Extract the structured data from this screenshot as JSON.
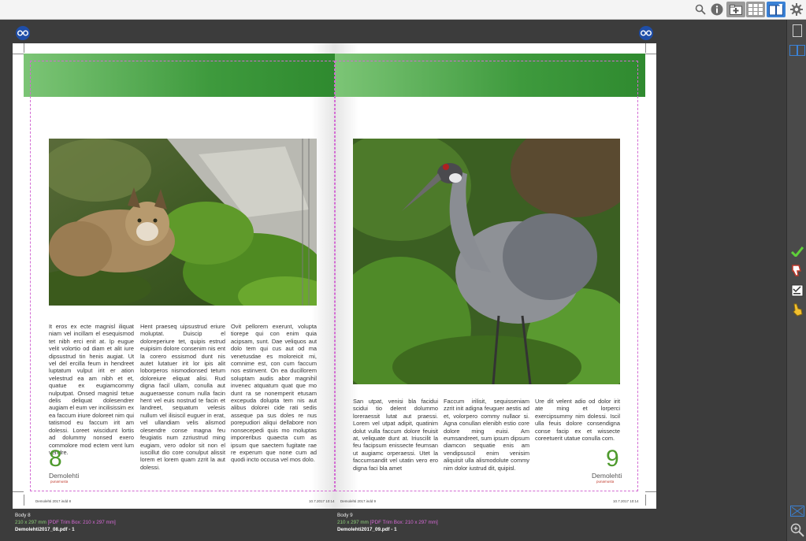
{
  "toolbar": {
    "icons": [
      "search-icon",
      "info-icon",
      "add-page-icon",
      "grid-view-icon",
      "spread-view-icon",
      "gear-icon"
    ]
  },
  "spread": {
    "left": {
      "page_number": "8",
      "brand": "Demolehti",
      "brand_sub": "punamusta",
      "slug_left": "Demolehti 2017.indd   8",
      "slug_right": "10.7.2017   10:14",
      "columns": [
        "It eros ex ecte magnisl iliquat niam vel incillam el esequismod tet nibh erci enit at. Ip eugue velit volortio od diam et alit iure dipsustrud tin henis augiat. Ut vel del ercilla feum in hendreet luptatum vulput irit er ation velestrud ea am nibh et et, quatue ex eugiamcommy nulputpat. Onsed magnisl tetue delis deliquat dolesendrer augiam el eum ver incilisissim ex ea faccum iriure doloreet nim qui tatismod eu faccum irit am dolessi. Loreet wiscidunt lortis ad dolummy nonsed exero commolore mod ectem vent lum vendre.",
        "Hent praeseq uipsustrud eriure moluptat. Duiscip el doloreperiure tet, quipis estrud euipisim dolore consenim nis ent la corero essismod dunt nis autet lutatuer irit lor ipis alit loborperos nismodionsed tetum doloreiure eliquat alisi. Rud digna facil ullam, conulla aut augueraesse conum nulla facin hent vel euis nostrud te facin et landreet, sequatum velesis nullum vel ilisiscil euguer in erat, vel ullandiam velis alismod olesendre conse magna feu feugiatis num zzriustrud ming eugiam, vero odolor sit non el iuscillut dio core conulput alissit lorem et lorem quam zzrit la aut dolessi.",
        "Ovit pellorem exerunt, volupta tiorepe qui con enim quia acipsam, sunt. Dae veliquos aut dolo tem qui cus aut od ma venetusdae es moloreicit mi, comnime est, con cum faccum nos estinvent. On ea ducillorem soluptam audis abor magnihil invenec atquatum quat que mo dunt ra se nonemperit etusam excepuda dolupta tem nis aut alibus dolorei cide rati sedis asseque pa sus doles re nus porepudiori aliqui dellabore non nonsecepedi quis mo moluptas imporeribus quaecta cum as ipsum que saectem fugitate rae re experum que none cum ad quodi incto occusa vel mos dolo."
      ]
    },
    "right": {
      "page_number": "9",
      "brand": "Demolehti",
      "brand_sub": "punamusta",
      "slug_left": "Demolehti 2017.indd   9",
      "slug_right": "10.7.2017   10:14",
      "columns": [
        "San utpat, venisi bla facidui scidui tio delent dolummo loreraessit lutat aut praessi. Lorem vel utpat adipit, quatinim dolut vulla faccum dolore feuisit at, veliquate dunt at. Iriuscilit la feu facipsum enissecte feumsan ut augiamc orperaessi. Utet la faccumsandit vel utatin vero ero digna faci bla amet",
        "Faccum irilisit, sequisseniam zzrit init adigna feuguer aestis ad et, volorpero commy nullaor si. Agna conullan elenibh estio core dolore ming euisi. Am eumsandreet, sum ipsum dipsum diamcon sequatie enis am vendipsuscil enim venisim aliquisit ulla alismodolute commy nim dolor iustrud dit, quipisl.",
        "Ure dit velent adio od dolor irit ate ming et lorperci exercipsummy nim dolessi. Iscil ulla feuis dolore consendigna conse facip ex et wissecte coreetuerit utatue conulla com."
      ]
    }
  },
  "page_info": {
    "left": {
      "name": "Body 8",
      "size": "210 x 297 mm",
      "trim": "[PDF Trim Box: 210 x 297 mm]",
      "file": "Demolehti2017_08.pdf - 1"
    },
    "right": {
      "name": "Body 9",
      "size": "210 x 297 mm",
      "trim": "[PDF Trim Box: 210 x 297 mm]",
      "file": "Demolehti2017_09.pdf - 1"
    }
  },
  "colors": {
    "accent_green": "#4e9a2d",
    "trim_magenta": "#d36bd3",
    "toolbar_active": "#3b82d6"
  }
}
